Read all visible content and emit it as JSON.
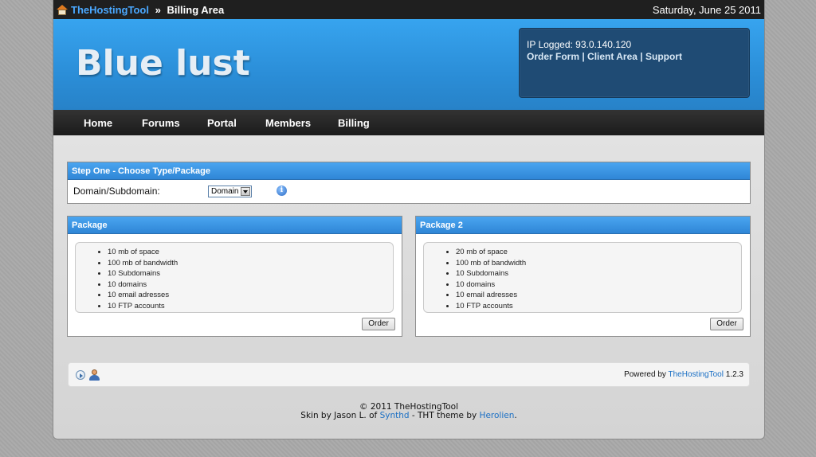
{
  "topbar": {
    "brand": "TheHostingTool",
    "separator": " » ",
    "section": "Billing Area",
    "date": "Saturday, June 25 2011"
  },
  "header": {
    "site_title": "Blue lust",
    "ip_logged": "IP Logged: 93.0.140.120",
    "links": [
      "Order Form",
      "Client Area",
      "Support"
    ],
    "link_separator": " | "
  },
  "nav": {
    "items": [
      "Home",
      "Forums",
      "Portal",
      "Members",
      "Billing"
    ]
  },
  "step_one": {
    "title": "Step One - Choose Type/Package",
    "field_label": "Domain/Subdomain:",
    "select_value": "Domain"
  },
  "packages": [
    {
      "title": "Package",
      "features": [
        "10 mb of space",
        "100 mb of bandwidth",
        "10 Subdomains",
        "10 domains",
        "10 email adresses",
        "10 FTP accounts"
      ],
      "button": "Order"
    },
    {
      "title": "Package 2",
      "features": [
        "20 mb of space",
        "100 mb of bandwidth",
        "10 Subdomains",
        "10 domains",
        "10 email adresses",
        "10 FTP accounts"
      ],
      "button": "Order"
    }
  ],
  "footer": {
    "powered_prefix": "Powered by ",
    "powered_link": "TheHostingTool",
    "powered_version": " 1.2.3",
    "copyright": "© 2011 TheHostingTool",
    "skin_prefix": "Skin by Jason L. of ",
    "skin_link": "Synthd",
    "skin_middle": " - THT theme by ",
    "theme_link": "Herolien",
    "skin_suffix": "."
  },
  "icons": {
    "home": "home-icon",
    "info": "info-icon",
    "footer_1": "play-circle-icon",
    "footer_2": "user-icon"
  }
}
